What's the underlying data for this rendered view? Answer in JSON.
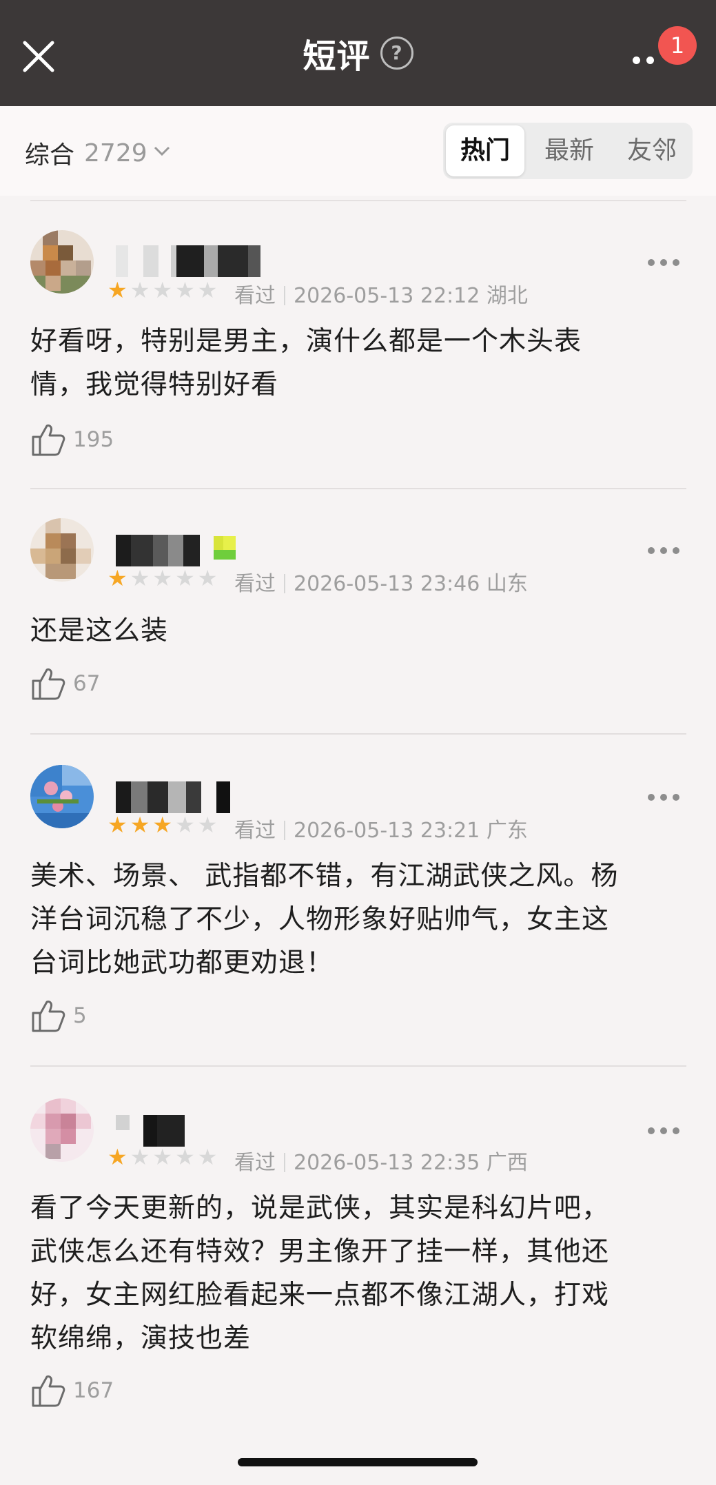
{
  "header": {
    "title": "短评",
    "help_glyph": "?",
    "notification_count": "1"
  },
  "filter": {
    "sort_label": "综合",
    "total_count": "2729",
    "tabs": [
      {
        "label": "热门",
        "active": true
      },
      {
        "label": "最新",
        "active": false
      },
      {
        "label": "友邻",
        "active": false
      }
    ]
  },
  "reviews": [
    {
      "rating": 1,
      "status": "看过",
      "time": "2026-05-13 22:12",
      "location": "湖北",
      "lines": [
        "好看呀，特别是男主，演什么都是一个木头表",
        "情，我觉得特别好看"
      ],
      "likes": "195"
    },
    {
      "rating": 1,
      "status": "看过",
      "time": "2026-05-13 23:46",
      "location": "山东",
      "lines": [
        "还是这么装"
      ],
      "likes": "67"
    },
    {
      "rating": 3,
      "status": "看过",
      "time": "2026-05-13 23:21",
      "location": "广东",
      "lines": [
        "美术、场景、 武指都不错，有江湖武侠之风。杨",
        "洋台词沉稳了不少，人物形象好贴帅气，女主这",
        "台词比她武功都更劝退！"
      ],
      "likes": "5"
    },
    {
      "rating": 1,
      "status": "看过",
      "time": "2026-05-13 22:35",
      "location": "广西",
      "lines": [
        "看了今天更新的，说是武侠，其实是科幻片吧，",
        "武侠怎么还有特效？男主像开了挂一样，其他还",
        "好，女主网红脸看起来一点都不像江湖人，打戏",
        "软绵绵，演技也差"
      ],
      "likes": "167"
    }
  ]
}
